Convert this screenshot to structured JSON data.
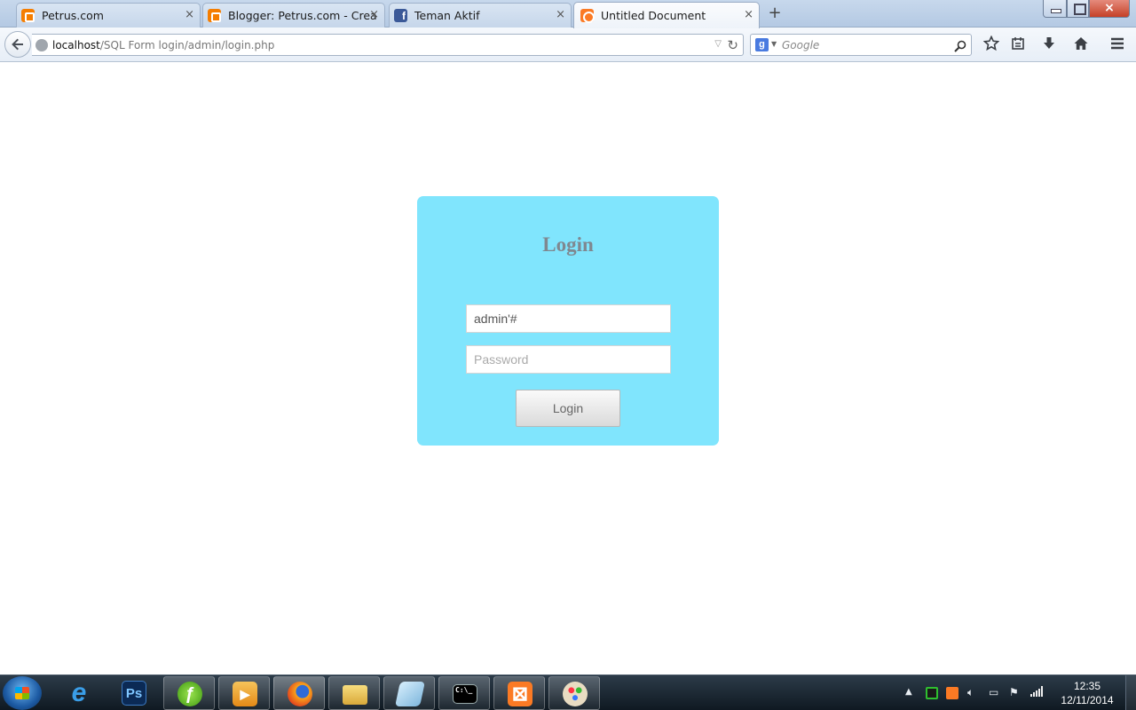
{
  "browser": {
    "tabs": [
      {
        "label": "Petrus.com",
        "favicon": "blogger-icon"
      },
      {
        "label": "Blogger: Petrus.com - Crea...",
        "favicon": "blogger-icon"
      },
      {
        "label": "Teman Aktif",
        "favicon": "facebook-icon"
      },
      {
        "label": "Untitled Document",
        "favicon": "xampp-icon",
        "active": true
      }
    ],
    "close_glyph": "×",
    "new_tab_glyph": "+",
    "url": {
      "host": "localhost",
      "path": "/SQL Form login/admin/login.php"
    },
    "search": {
      "engine_letter": "g",
      "placeholder": "Google"
    }
  },
  "login": {
    "title": "Login",
    "username_value": "admin'#",
    "password_placeholder": "Password",
    "button_label": "Login",
    "box_color": "#80e5fd"
  },
  "taskbar": {
    "apps": [
      {
        "name": "internet-explorer-icon",
        "glyph": "e"
      },
      {
        "name": "photoshop-icon",
        "glyph": "Ps"
      },
      {
        "name": "dreamweaver-icon",
        "glyph": "ƒ"
      },
      {
        "name": "media-player-icon",
        "glyph": "▶"
      },
      {
        "name": "firefox-icon",
        "glyph": ""
      },
      {
        "name": "file-explorer-icon",
        "glyph": ""
      },
      {
        "name": "notepad-icon",
        "glyph": ""
      },
      {
        "name": "command-prompt-icon",
        "glyph": "C:\\_"
      },
      {
        "name": "xampp-control-icon",
        "glyph": "⊠"
      },
      {
        "name": "paint-icon",
        "glyph": ""
      }
    ],
    "clock": {
      "time": "12:35",
      "date": "12/11/2014"
    }
  }
}
